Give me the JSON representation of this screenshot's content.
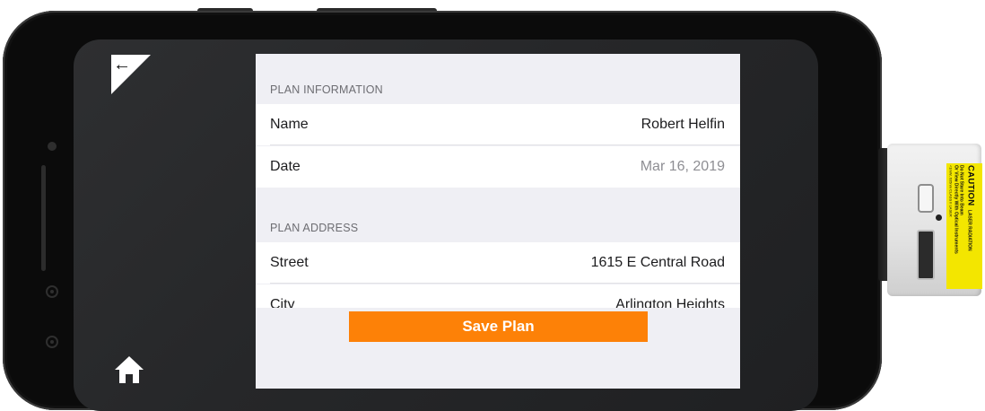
{
  "screen": {
    "back_icon": "back-arrow-icon",
    "home_icon": "home-icon"
  },
  "plan_information": {
    "header": "PLAN INFORMATION",
    "rows": [
      {
        "label": "Name",
        "value": "Robert Helfin"
      },
      {
        "label": "Date",
        "value": "Mar 16, 2019"
      }
    ]
  },
  "plan_address": {
    "header": "PLAN ADDRESS",
    "rows": [
      {
        "label": "Street",
        "value": "1615 E  Central Road"
      },
      {
        "label": "City",
        "value": "Arlington Heights"
      }
    ]
  },
  "actions": {
    "save_label": "Save Plan"
  },
  "colors": {
    "accent": "#fd8107",
    "panel_bg": "#efeff4",
    "muted_value": "#8e8e93"
  },
  "laser_label": {
    "caution": "CAUTION",
    "warning": "LASER RADIATION",
    "line1": "Do Not Stare Into Beam",
    "line2": "Or View Directly With Optical Instruments",
    "line3": "<1mW, 635nm CLASS II LASER"
  }
}
